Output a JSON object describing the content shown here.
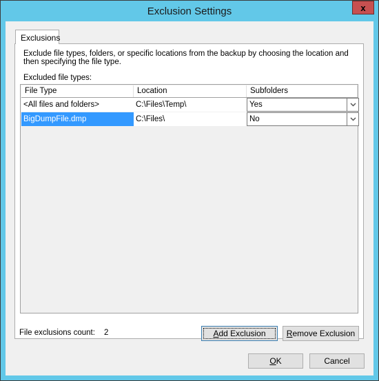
{
  "window": {
    "title": "Exclusion Settings",
    "close_label": "x"
  },
  "tabs": [
    {
      "label": "Exclusions",
      "active": true
    }
  ],
  "exclusions": {
    "description": "Exclude file types, folders, or specific locations from the backup by choosing the location and then specifying the file type.",
    "list_label": "Excluded file types:",
    "columns": [
      "File Type",
      "Location",
      "Subfolders"
    ],
    "rows": [
      {
        "file_type": "<All files and folders>",
        "location": "C:\\Files\\Temp\\",
        "subfolders": "Yes",
        "selected": false
      },
      {
        "file_type": "BigDumpFile.dmp",
        "location": "C:\\Files\\",
        "subfolders": "No",
        "selected": true
      }
    ],
    "count_label": "File exclusions count:",
    "count_value": "2",
    "add_button": {
      "mnemonic": "A",
      "rest": "dd Exclusion"
    },
    "remove_button": {
      "mnemonic": "R",
      "rest": "emove Exclusion"
    }
  },
  "footer": {
    "ok_button": {
      "mnemonic": "O",
      "rest": "K"
    },
    "cancel_button": "Cancel"
  },
  "colors": {
    "titlebar": "#62c8e8",
    "close": "#c75050",
    "selection": "#3399ff"
  }
}
